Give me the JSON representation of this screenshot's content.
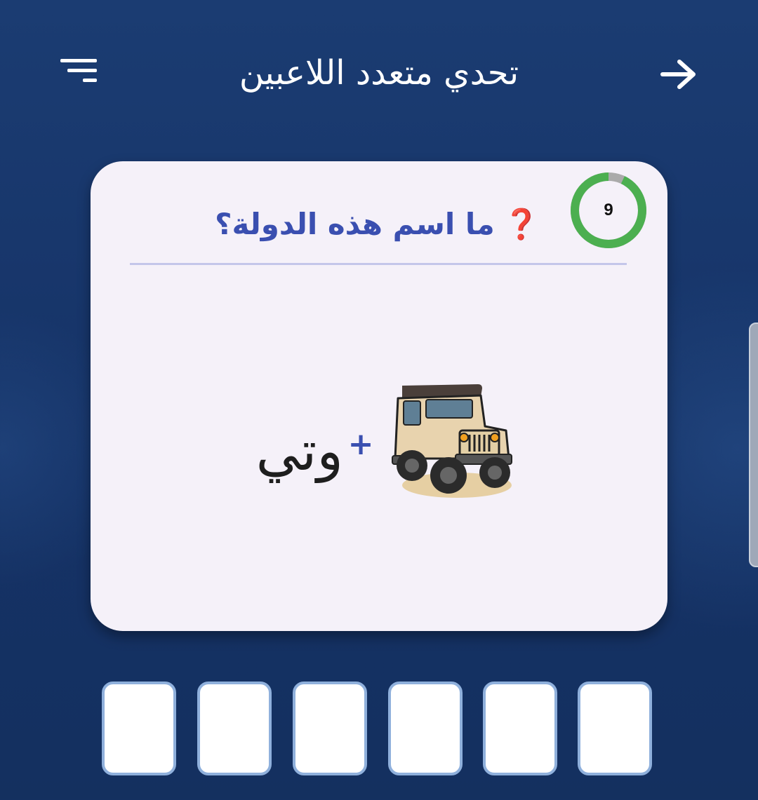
{
  "header": {
    "title": "تحدي متعدد اللاعبين",
    "menu_icon": "filter-menu-icon",
    "back_icon": "arrow-right-icon"
  },
  "card": {
    "question_mark": "❓",
    "question": "ما اسم هذه الدولة؟",
    "timer": {
      "value": "9",
      "remaining_fraction": 0.93,
      "ring_color": "#4caf50",
      "elapsed_color": "#aaaaaa"
    },
    "puzzle": {
      "image": "jeep-image",
      "plus": "+",
      "word": "وتي"
    }
  },
  "answer_slots": {
    "count": 6,
    "values": [
      "",
      "",
      "",
      "",
      "",
      ""
    ]
  },
  "colors": {
    "background": "#1a3a6e",
    "card": "#f5f1f9",
    "accent": "#3a4fb0",
    "slot_border": "#8fb0dc"
  }
}
